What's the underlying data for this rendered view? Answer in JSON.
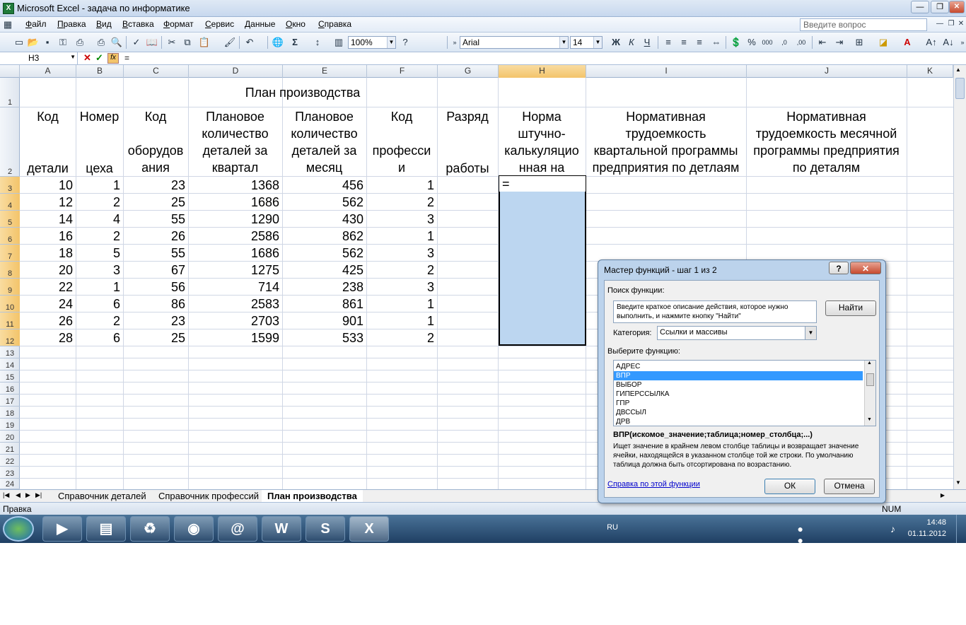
{
  "window": {
    "title": "Microsoft Excel - задача по информатике"
  },
  "menu": {
    "items": [
      "Файл",
      "Правка",
      "Вид",
      "Вставка",
      "Формат",
      "Сервис",
      "Данные",
      "Окно",
      "Справка"
    ],
    "question_placeholder": "Введите вопрос"
  },
  "toolbar": {
    "zoom": "100%",
    "font": "Arial",
    "size": "14"
  },
  "formula_bar": {
    "name_box": "H3",
    "formula": "="
  },
  "columns": [
    "A",
    "B",
    "C",
    "D",
    "E",
    "F",
    "G",
    "H",
    "I",
    "J",
    "K"
  ],
  "rows": [
    "1",
    "2",
    "3",
    "4",
    "5",
    "6",
    "7",
    "8",
    "9",
    "10",
    "11",
    "12",
    "13",
    "14",
    "15",
    "16",
    "17",
    "18",
    "19",
    "20",
    "21",
    "22",
    "23",
    "24"
  ],
  "sheet": {
    "title": "План производства",
    "headers": {
      "A": {
        "top": "Код",
        "bottom": "детали"
      },
      "B": {
        "top": "Номер",
        "bottom": "цеха"
      },
      "C": "Код\n\nоборудов\nания",
      "D": "Плановое\nколичество\nдеталей за\nквартал",
      "E": "Плановое\nколичество\nдеталей за\nмесяц",
      "F": "Код\n\nпрофесси\nи",
      "G": {
        "top": "Разряд",
        "bottom": "работы"
      },
      "H": "Норма\nштучно-\nкалькуляцио\nнная на",
      "I": "Нормативная\nтрудоемкость\nквартальной программы\nпредприятия по детлаям",
      "J": "Нормативная\nтрудоемкость месячной\nпрограммы предприятия\nпо деталям"
    },
    "data": [
      [
        "10",
        "1",
        "23",
        "1368",
        "456",
        "1"
      ],
      [
        "12",
        "2",
        "25",
        "1686",
        "562",
        "2"
      ],
      [
        "14",
        "4",
        "55",
        "1290",
        "430",
        "3"
      ],
      [
        "16",
        "2",
        "26",
        "2586",
        "862",
        "1"
      ],
      [
        "18",
        "5",
        "55",
        "1686",
        "562",
        "3"
      ],
      [
        "20",
        "3",
        "67",
        "1275",
        "425",
        "2"
      ],
      [
        "22",
        "1",
        "56",
        "714",
        "238",
        "3"
      ],
      [
        "24",
        "6",
        "86",
        "2583",
        "861",
        "1"
      ],
      [
        "26",
        "2",
        "23",
        "2703",
        "901",
        "1"
      ],
      [
        "28",
        "6",
        "25",
        "1599",
        "533",
        "2"
      ]
    ],
    "active_cell_value": "="
  },
  "tabs": {
    "items": [
      "Справочник деталей",
      "Справочник профессий",
      "План производства"
    ],
    "active": "План производства"
  },
  "status": {
    "mode": "Правка",
    "num": "NUM"
  },
  "dialog": {
    "title": "Мастер функций - шаг 1 из 2",
    "help_icon": "?",
    "search_label": "Поиск функции:",
    "search_text": "Введите краткое описание действия, которое нужно выполнить, и нажмите кнопку \"Найти\"",
    "find_button": "Найти",
    "category_label": "Категория:",
    "category_value": "Ссылки и массивы",
    "choose_label": "Выберите функцию:",
    "functions": [
      "АДРЕС",
      "ВПР",
      "ВЫБОР",
      "ГИПЕРССЫЛКА",
      "ГПР",
      "ДВССЫЛ",
      "ДРВ"
    ],
    "selected_function": "ВПР",
    "signature": "ВПР(искомое_значение;таблица;номер_столбца;...)",
    "description": "Ищет значение в крайнем левом столбце таблицы и возвращает значение ячейки, находящейся в указанном столбце той же строки. По умолчанию таблица должна быть отсортирована по возрастанию.",
    "help_link": "Справка по этой функции",
    "ok": "ОК",
    "cancel": "Отмена"
  },
  "taskbar": {
    "lang": "RU",
    "time": "14:48",
    "date": "01.11.2012"
  }
}
